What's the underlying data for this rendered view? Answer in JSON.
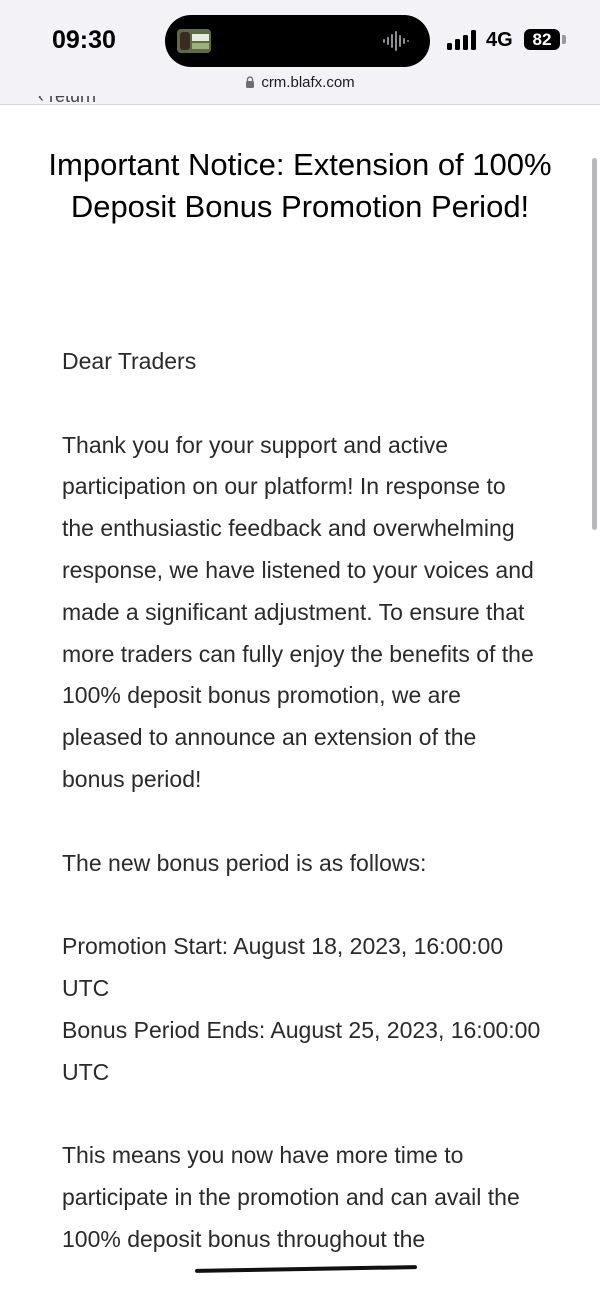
{
  "status_bar": {
    "time": "09:30",
    "network": "4G",
    "battery": "82",
    "icons": [
      "now-playing-thumbnail-icon",
      "audio-waveform-icon",
      "cellular-signal-icon",
      "battery-icon"
    ]
  },
  "browser": {
    "url": "crm.blafx.com",
    "icons": [
      "lock-icon"
    ]
  },
  "nav": {
    "return_label": "return",
    "icons": [
      "chevron-left-icon"
    ]
  },
  "article": {
    "title": "Important Notice: Extension of 100% Deposit Bonus Promotion Period!",
    "greeting": "Dear Traders",
    "paragraph_1": "Thank you for your support and active participation on our platform! In response to the enthusiastic feedback and overwhelming response, we have listened to your voices and made a significant adjustment. To ensure that more traders can fully enjoy the benefits of the 100% deposit bonus promotion, we are pleased to announce an extension of the bonus period!",
    "paragraph_2": "The new bonus period is as follows:",
    "promotion_start": "Promotion Start: August 18, 2023, 16:00:00 UTC",
    "bonus_period_ends": "Bonus Period Ends: August 25, 2023, 16:00:00 UTC",
    "paragraph_3": "This means you now have more time to participate in the promotion and can avail the 100% deposit bonus throughout the"
  },
  "colors": {
    "status_bar_bg": "#f2f2f7",
    "text": "#2a2a2a",
    "title": "#000000"
  }
}
